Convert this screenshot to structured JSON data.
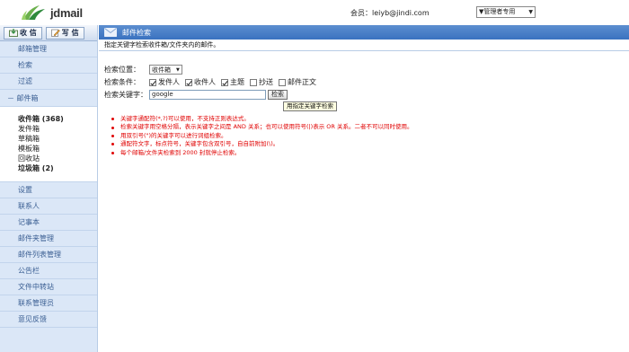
{
  "header": {
    "logo_text": "jdmail",
    "account": "会员：leiyb@jindi.com",
    "role_select": "▼管理者专用"
  },
  "toolbar": {
    "receive_label": "收 信",
    "compose_label": "写 信"
  },
  "sidebar": {
    "top_items": [
      {
        "label": "邮箱管理"
      },
      {
        "label": "检索"
      },
      {
        "label": "过滤"
      }
    ],
    "mailbox_group": "－ 邮件箱",
    "folders": [
      {
        "label": "收件箱 (368)"
      },
      {
        "label": "发件箱"
      },
      {
        "label": "草稿箱"
      },
      {
        "label": "模板箱"
      },
      {
        "label": "回收站"
      },
      {
        "label": "垃圾箱 (2)"
      }
    ],
    "bottom_items": [
      {
        "label": "设置"
      },
      {
        "label": "联系人"
      },
      {
        "label": "记事本"
      },
      {
        "label": "邮件夹管理"
      },
      {
        "label": "邮件列表管理"
      },
      {
        "label": "公告栏"
      },
      {
        "label": "文件中转站"
      },
      {
        "label": "联系管理员"
      },
      {
        "label": "意见反馈"
      }
    ]
  },
  "main": {
    "title": "邮件检索",
    "description": "指定关键字检索收件箱/文件夹内的邮件。",
    "location_label": "检索位置：",
    "location_value": "收件箱",
    "condition_label": "检索条件：",
    "conditions": [
      {
        "label": "发件人",
        "checked": true
      },
      {
        "label": "收件人",
        "checked": true
      },
      {
        "label": "主题",
        "checked": true
      },
      {
        "label": "抄送",
        "checked": false
      },
      {
        "label": "邮件正文",
        "checked": false
      }
    ],
    "keyword_label": "检索关键字：",
    "keyword_value": "google",
    "search_button": "检索",
    "tooltip": "用指定关键字检索",
    "notes": [
      "关键字通配符(*,?)可以使用，不支持正则表达式。",
      "检索关键字用空格分隔，表示关键字之间是 AND 关系；也可以使用符号(|)表示 OR 关系。二者不可以同时使用。",
      "用双引号(\")的关键字可以进行词组检索。",
      "通配符文字，标点符号，关键字包含双引号，自自前附加(\\)。",
      "每个邮箱/文件夹检索到 2000 封就停止检索。"
    ]
  },
  "colors": {
    "title_bar": "#3a72c0",
    "sidebar_bg": "#dbe7f7",
    "nav_text": "#3b5f93",
    "note_text": "#e00000"
  }
}
